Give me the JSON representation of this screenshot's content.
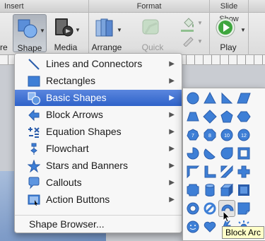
{
  "ribbon": {
    "groups": {
      "insert": "Insert",
      "format": "Format",
      "slideshow": "Slide Show"
    },
    "buttons": {
      "picture_partial": "re",
      "shape": "Shape",
      "media": "Media",
      "arrange": "Arrange",
      "quick_styles": "Quick Styles",
      "play": "Play"
    }
  },
  "shape_menu": {
    "items": [
      {
        "label": "Lines and Connectors",
        "icon": "line-icon"
      },
      {
        "label": "Rectangles",
        "icon": "rectangle-icon"
      },
      {
        "label": "Basic Shapes",
        "icon": "basic-shapes-icon",
        "selected": true
      },
      {
        "label": "Block Arrows",
        "icon": "block-arrow-icon"
      },
      {
        "label": "Equation Shapes",
        "icon": "equation-icon"
      },
      {
        "label": "Flowchart",
        "icon": "flowchart-icon"
      },
      {
        "label": "Stars and Banners",
        "icon": "star-icon"
      },
      {
        "label": "Callouts",
        "icon": "callout-icon"
      },
      {
        "label": "Action Buttons",
        "icon": "action-button-icon"
      }
    ],
    "footer": "Shape Browser...",
    "selection_color": "#3a6fd4"
  },
  "basic_shapes": {
    "hovered": "block-arc",
    "tooltip": "Block Arc",
    "shape_color": "#3e7fd6",
    "rows": [
      [
        "oval",
        "triangle",
        "right-triangle",
        "parallelogram"
      ],
      [
        "trapezoid",
        "diamond",
        "pentagon",
        "hexagon"
      ],
      [
        "heptagon",
        "octagon",
        "decagon",
        "dodecagon"
      ],
      [
        "pie",
        "chord",
        "teardrop",
        "frame"
      ],
      [
        "half-frame",
        "l-shape",
        "diagonal-stripe",
        "plus"
      ],
      [
        "plaque",
        "can",
        "cube",
        "bevel"
      ],
      [
        "donut",
        "no-symbol",
        "block-arc",
        "folded-corner"
      ],
      [
        "smiley-face",
        "heart",
        "lightning-bolt",
        "sun"
      ]
    ]
  }
}
